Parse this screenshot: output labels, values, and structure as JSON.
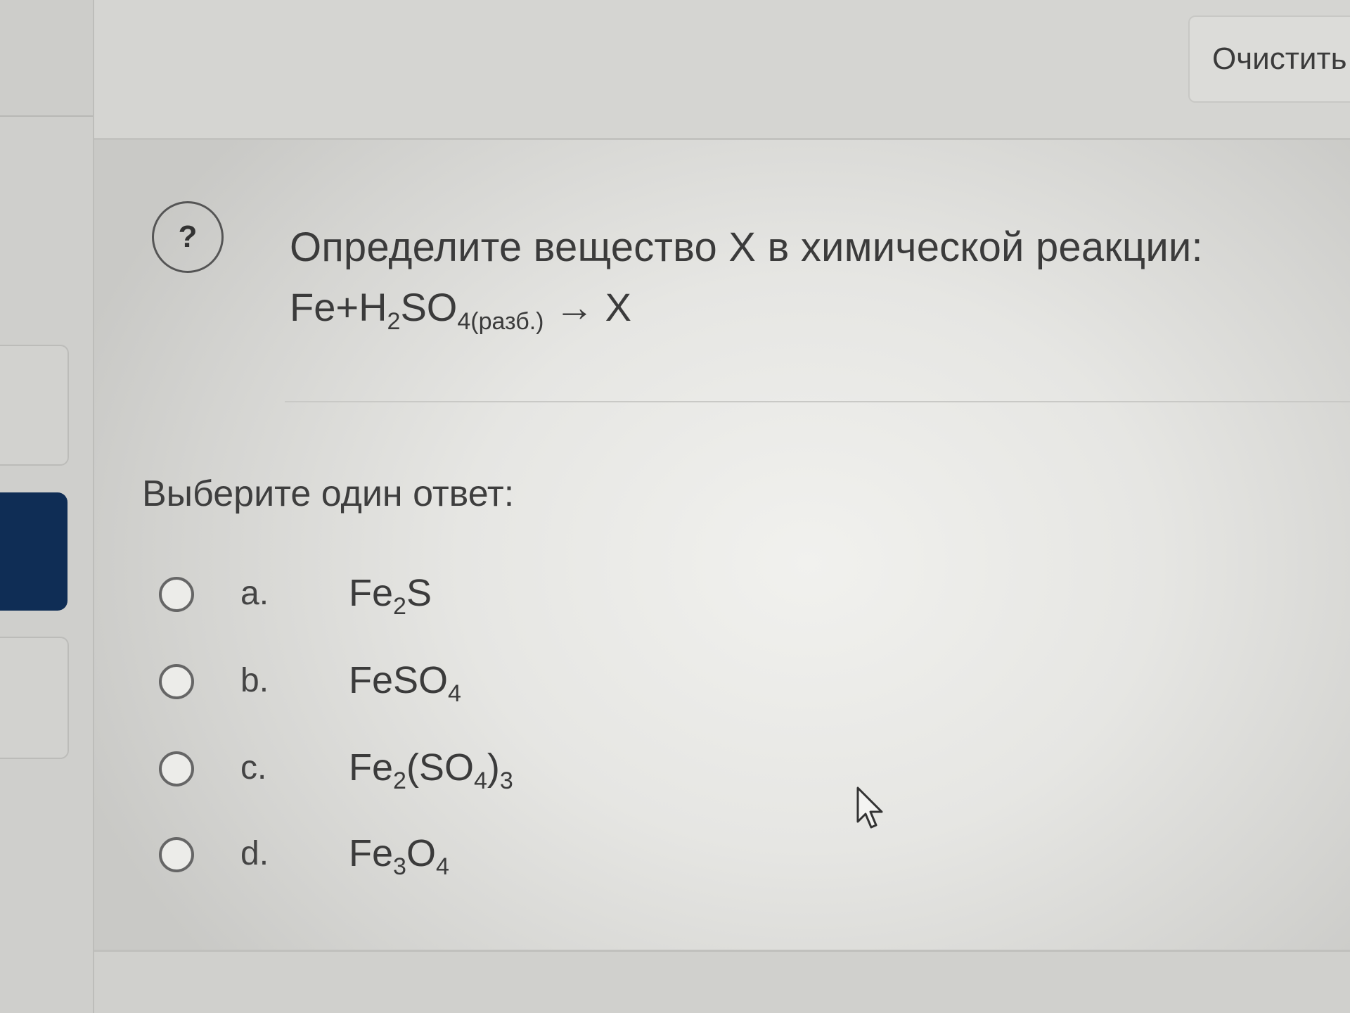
{
  "header": {
    "clear_label": "Очистить"
  },
  "question": {
    "icon_symbol": "?",
    "text": "Определите вещество X в химической реакции:",
    "equation": {
      "reactant1": "Fe",
      "plus": "+",
      "reactant2_a": "H",
      "reactant2_sub": "2",
      "reactant2_b": "SO",
      "reactant2_sub2": "4(разб.)",
      "arrow": " → X"
    }
  },
  "prompt": "Выберите один ответ:",
  "options": [
    {
      "letter": "a.",
      "parts": [
        "Fe",
        "2",
        "S"
      ]
    },
    {
      "letter": "b.",
      "parts": [
        "FeSO",
        "4"
      ]
    },
    {
      "letter": "c.",
      "parts": [
        "Fe",
        "2",
        "(SO",
        "4",
        ")",
        "3"
      ]
    },
    {
      "letter": "d.",
      "parts": [
        "Fe",
        "3",
        "O",
        "4"
      ]
    }
  ],
  "icons": {
    "question": "question-circle-icon",
    "cursor": "mouse-pointer-icon"
  }
}
